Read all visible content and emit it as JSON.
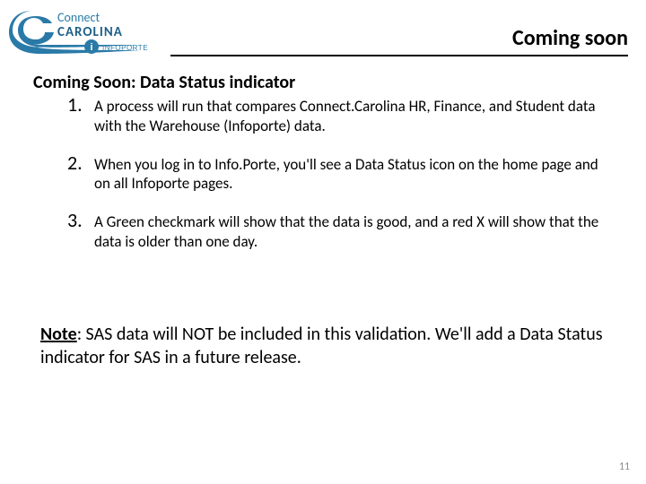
{
  "header": {
    "logo_primary": "Connect",
    "logo_secondary": "CAROLINA",
    "logo_badge": "INFOPORTE",
    "title": "Coming soon"
  },
  "subtitle": {
    "lead": "Coming Soon:",
    "rest": "  Data Status indicator"
  },
  "items": [
    {
      "num": "1.",
      "text": "A process will run that compares Connect.Carolina HR, Finance, and Student data with the Warehouse (Infoporte) data."
    },
    {
      "num": "2.",
      "text": "When you log in to Info.Porte, you'll see a Data Status icon on the home page and on all Infoporte pages."
    },
    {
      "num": "3.",
      "text": "A Green checkmark will show that the data is good, and a red X will show that the data is older than one day."
    }
  ],
  "note": {
    "lead": "Note",
    "body": ": SAS data will NOT be included in this validation.  We'll add a Data Status indicator for SAS in a future release."
  },
  "page_number": "11"
}
